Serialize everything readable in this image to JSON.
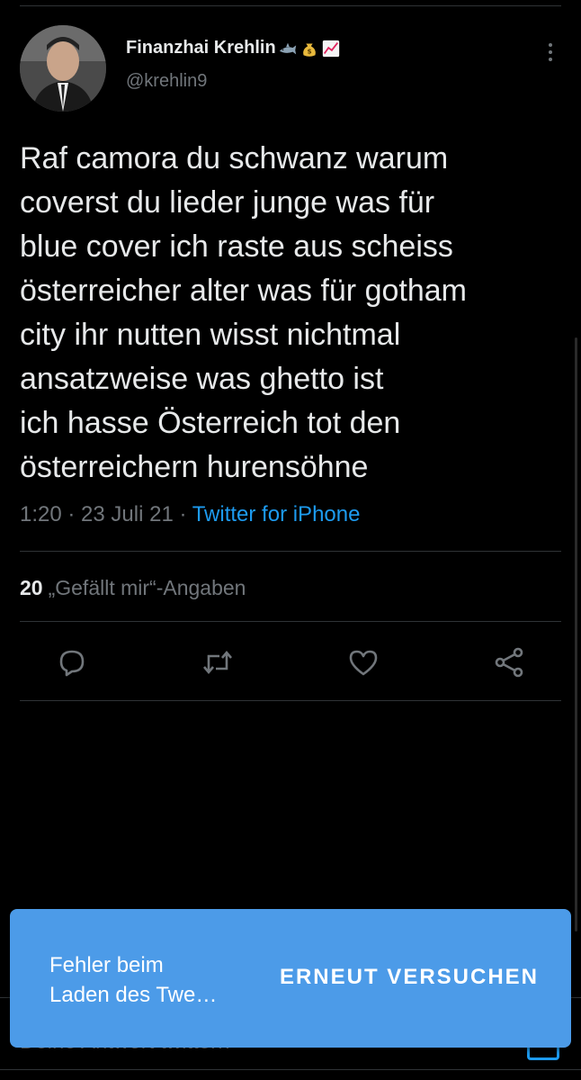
{
  "colors": {
    "background": "#000000",
    "text_primary": "#e7e9ea",
    "text_secondary": "#71767b",
    "accent": "#1d9bf0",
    "divider": "#2f3336",
    "snackbar": "#4c9be8"
  },
  "tweet": {
    "author": {
      "display_name": "Finanzhai Krehlin",
      "emojis": [
        "shark-emoji",
        "money-bag-emoji",
        "chart-increasing-emoji"
      ],
      "handle": "@krehlin9"
    },
    "text": "Raf camora du schwanz warum\ncoverst du lieder junge was für\nblue cover ich raste aus scheiss\nösterreicher alter was für gotham\ncity ihr nutten wisst nichtmal\nansatzweise was ghetto ist\nich hasse Österreich tot den\nösterreichern hurensöhne",
    "time": "1:20",
    "date": "23 Juli 21",
    "source": "Twitter for iPhone",
    "separator": " · ",
    "likes_count": "20",
    "likes_label": "„Gefällt mir“-Angaben"
  },
  "actions": {
    "reply_icon": "reply-icon",
    "retweet_icon": "retweet-icon",
    "like_icon": "heart-icon",
    "share_icon": "share-icon"
  },
  "reply_bar": {
    "placeholder": "Deine Antwort twittern"
  },
  "snackbar": {
    "message": "Fehler beim\nLaden des Twe…",
    "action_label": "ERNEUT VERSUCHEN"
  }
}
